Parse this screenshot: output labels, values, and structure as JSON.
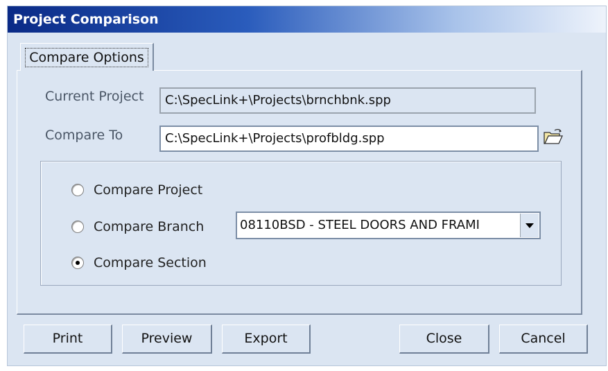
{
  "window": {
    "title": "Project Comparison"
  },
  "tabs": [
    {
      "label": "Compare Options"
    }
  ],
  "current_project": {
    "label": "Current Project",
    "value": "C:\\SpecLink+\\Projects\\brnchbnk.spp"
  },
  "compare_to": {
    "label": "Compare To",
    "value": "C:\\SpecLink+\\Projects\\profbldg.spp"
  },
  "options": [
    {
      "label": "Compare Project",
      "checked": false
    },
    {
      "label": "Compare Branch",
      "checked": false
    },
    {
      "label": "Compare Section",
      "checked": true
    }
  ],
  "section_select": {
    "selected": "08110BSD - STEEL DOORS AND FRAMI"
  },
  "buttons": {
    "print": "Print",
    "preview": "Preview",
    "export": "Export",
    "close": "Close",
    "cancel": "Cancel"
  },
  "icons": {
    "browse": "open-folder-icon",
    "dropdown": "chevron-down-icon"
  }
}
